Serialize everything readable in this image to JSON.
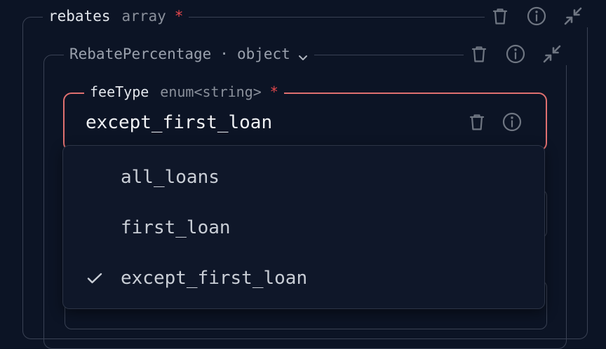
{
  "outer": {
    "name": "rebates",
    "type": "array",
    "required_mark": "*"
  },
  "mid": {
    "name": "RebatePercentage",
    "separator": "·",
    "type": "object"
  },
  "field": {
    "name": "feeType",
    "type": "enum<string>",
    "required_mark": "*",
    "value": "except_first_loan"
  },
  "dropdown": {
    "options": [
      {
        "label": "all_loans",
        "selected": false
      },
      {
        "label": "first_loan",
        "selected": false
      },
      {
        "label": "except_first_loan",
        "selected": true
      }
    ]
  },
  "icons": {
    "delete": "trash-icon",
    "info": "info-icon",
    "collapse": "collapse-icon",
    "chevron": "chevron-down-icon",
    "check": "check-icon"
  },
  "colors": {
    "background": "#0c1425",
    "border": "#3a4254",
    "required": "#e5484d",
    "active_border": "#e07070",
    "icon": "#6f7682"
  }
}
